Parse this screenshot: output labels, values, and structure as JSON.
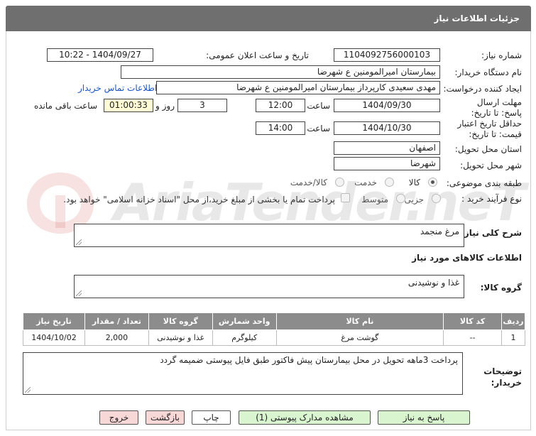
{
  "header": {
    "title": "جزئیات اطلاعات نیاز"
  },
  "watermark": {
    "text": "AriaTender.neT"
  },
  "form": {
    "need_number_label": "شماره نیاز:",
    "need_number": "1104092756000103",
    "announce_label": "تاریخ و ساعت اعلان عمومی:",
    "announce_value": "1404/09/27 - 10:22",
    "buyer_org_label": "نام دستگاه خریدار:",
    "buyer_org": "بیمارستان امیرالمومنین ع  شهرضا",
    "creator_label": "ایجاد کننده درخواست:",
    "creator": "مهدی سعیدی کارپرداز بیمارستان امیرالمومنین ع  شهرضا",
    "contact_link": "اطلاعات تماس خریدار",
    "deadline_label": "مهلت ارسال پاسخ: تا تاریخ:",
    "deadline_date": "1404/09/30",
    "time_label": "ساعت",
    "deadline_time": "12:00",
    "days": "3",
    "days_label": "روز و",
    "remaining": "01:00:33",
    "remaining_label": "ساعت باقی مانده",
    "validity_label": "حداقل تاریخ اعتبار قیمت: تا تاریخ:",
    "validity_date": "1404/10/30",
    "validity_time": "14:00",
    "province_label": "استان محل تحویل:",
    "province": "اصفهان",
    "city_label": "شهر محل تحویل:",
    "city": "شهرضا",
    "category_label": "طبقه بندی موضوعی:",
    "category_options": [
      "کالا",
      "خدمت",
      "کالا/خدمت"
    ],
    "process_label": "نوع فرآیند خرید :",
    "process_options": [
      "جزیی",
      "متوسط"
    ],
    "payment_note": "پرداخت تمام یا بخشی از مبلغ خرید،از محل \"اسناد خزانه اسلامی\" خواهد بود.",
    "summary_label": "شرح کلی نیاز:",
    "summary": "مرغ منجمد",
    "goods_info_title": "اطلاعات کالاهای مورد نیاز",
    "goods_group_label": "گروه کالا:",
    "goods_group": "غذا و نوشیدنی",
    "buyer_notes_label": "توضیحات خریدار:",
    "buyer_notes": "پرداخت 3ماهه تحویل در محل بیمارستان پیش فاکتور طبق فایل پیوستی ضمیمه گردد"
  },
  "table": {
    "headers": [
      "ردیف",
      "کد کالا",
      "نام کالا",
      "واحد شمارش",
      "گروه کالا",
      "تعداد / مقدار",
      "تاریخ نیاز"
    ],
    "rows": [
      [
        "1",
        "--",
        "گوشت مرغ",
        "کیلوگرم",
        "غذا و نوشیدنی",
        "2,000",
        "1404/10/02"
      ]
    ]
  },
  "buttons": {
    "reply": "پاسخ به نیاز",
    "attachments": "مشاهده مدارک پیوستی (1)",
    "print": "چاپ",
    "back": "بازگشت",
    "exit": "خروج"
  },
  "colors": {
    "header_bg": "#6f6f6f",
    "table_header_bg": "#8c8c8c",
    "green_button": "#d9f5cf",
    "pink_button": "#f8d7d7",
    "link": "#1a55c8",
    "remaining_bg": "#fffbd4"
  }
}
